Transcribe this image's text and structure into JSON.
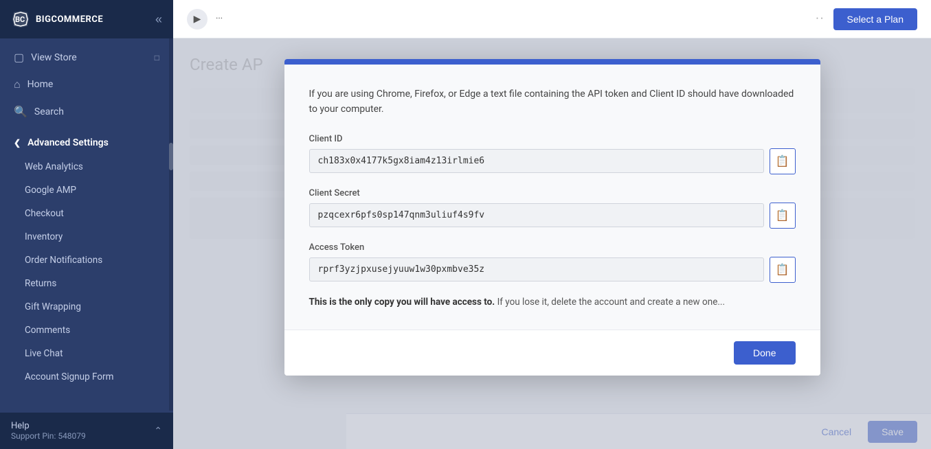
{
  "sidebar": {
    "logo_text": "BIGCOMMERCE",
    "nav_items": [
      {
        "id": "view-store",
        "label": "View Store",
        "icon": "🏠",
        "has_ext": true
      },
      {
        "id": "home",
        "label": "Home",
        "icon": "⌂",
        "has_ext": false
      },
      {
        "id": "search",
        "label": "Search",
        "icon": "🔍",
        "has_ext": false
      }
    ],
    "section_label": "Advanced Settings",
    "menu_items": [
      {
        "id": "web-analytics",
        "label": "Web Analytics"
      },
      {
        "id": "google-amp",
        "label": "Google AMP"
      },
      {
        "id": "checkout",
        "label": "Checkout"
      },
      {
        "id": "inventory",
        "label": "Inventory"
      },
      {
        "id": "order-notifications",
        "label": "Order Notifications"
      },
      {
        "id": "returns",
        "label": "Returns"
      },
      {
        "id": "gift-wrapping",
        "label": "Gift Wrapping"
      },
      {
        "id": "comments",
        "label": "Comments"
      },
      {
        "id": "live-chat",
        "label": "Live Chat"
      },
      {
        "id": "account-signup-form",
        "label": "Account Signup Form"
      }
    ],
    "footer": {
      "title": "Help",
      "support": "Support Pin: 548079"
    }
  },
  "topbar": {
    "icon_char": "▶",
    "title": "···",
    "dots": "··",
    "select_plan_label": "Select a Plan"
  },
  "page": {
    "title": "Create AP"
  },
  "modal": {
    "info_text": "If you are using Chrome, Firefox, or Edge a text file containing the API token and Client ID should have downloaded to your computer.",
    "client_id_label": "Client ID",
    "client_id_value": "ch183x0x4177k5gx8iam4z13irlmie6",
    "client_secret_label": "Client Secret",
    "client_secret_value": "pzqcexr6pfs0sp147qnm3uliuf4s9fv",
    "access_token_label": "Access Token",
    "access_token_value": "rprf3yzjpxusejyuuw1w30pxmbve35z",
    "warning_bold": "This is the only copy you will have access to.",
    "warning_rest": " If you lose it, delete the account and create a new one...",
    "done_label": "Done"
  },
  "bottom_bar": {
    "cancel_label": "Cancel",
    "save_label": "Save"
  }
}
